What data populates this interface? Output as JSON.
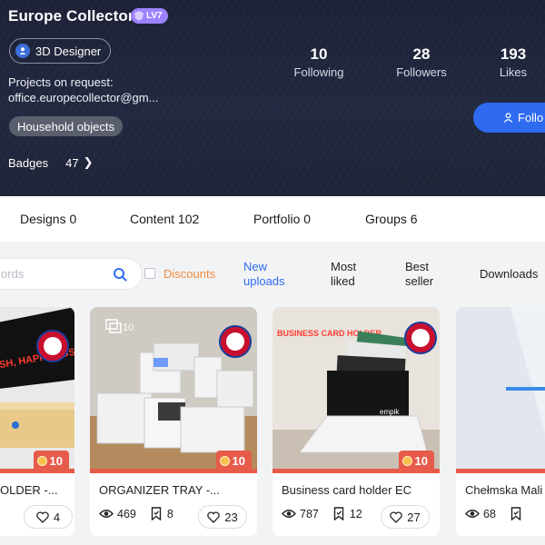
{
  "profile": {
    "name": "Europe Collector",
    "level": "LV7",
    "role": "3D Designer",
    "bio_line1": "Projects on request:",
    "bio_line2": "office.europecollector@gm...",
    "tag": "Household objects",
    "badges_label": "Badges",
    "badges_count": "47",
    "stats": [
      {
        "value": "10",
        "label": "Following"
      },
      {
        "value": "28",
        "label": "Followers"
      },
      {
        "value": "193",
        "label": "Likes"
      }
    ],
    "follow_label": "Follo"
  },
  "tabs": [
    {
      "label": "Designs 0"
    },
    {
      "label": "Content 102"
    },
    {
      "label": "Portfolio 0"
    },
    {
      "label": "Groups 6"
    }
  ],
  "filters": {
    "search_placeholder": "ords",
    "discounts_label": "Discounts",
    "sort": [
      {
        "line1": "New",
        "line2": "uploads",
        "active": true
      },
      {
        "line1": "Most",
        "line2": "liked"
      },
      {
        "line1": "Best",
        "line2": "seller"
      },
      {
        "line1": "Downloads",
        "line2": ""
      }
    ]
  },
  "cards": [
    {
      "name": "OLDER -...",
      "price": "10",
      "overlay": "PY FISH, HAPPY SUSHI",
      "likes": "4"
    },
    {
      "name": "ORGANIZER TRAY -...",
      "price": "10",
      "image_count": "10",
      "views": "469",
      "collects": "8",
      "likes": "23"
    },
    {
      "name": "Business card holder EC",
      "price": "10",
      "overlay": "BUSINESS CARD HOLDER",
      "views": "787",
      "collects": "12",
      "likes": "27"
    },
    {
      "name": "Chełmska Mali",
      "views": "68"
    }
  ],
  "colors": {
    "accent": "#2f6bf0",
    "discount": "#f08a3c",
    "price": "#e75b4a",
    "level": "#9c82ff"
  }
}
